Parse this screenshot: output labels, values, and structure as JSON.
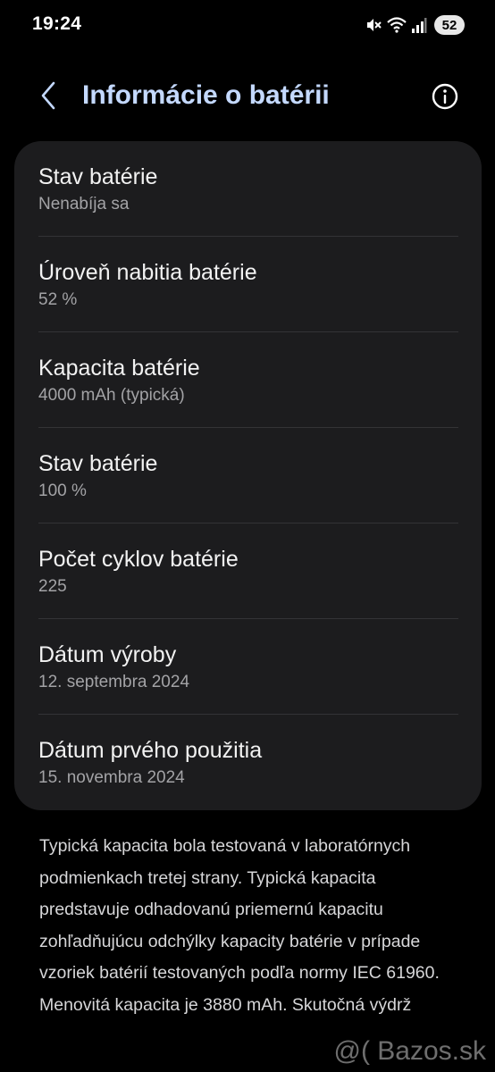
{
  "status_bar": {
    "time": "19:24",
    "battery_level": "52",
    "icons": [
      "mute-icon",
      "wifi-icon",
      "signal-icon",
      "battery-icon"
    ]
  },
  "header": {
    "title": "Informácie o batérii",
    "back_icon": "chevron-left-icon",
    "info_icon": "info-icon",
    "title_color": "#c4d9ff"
  },
  "items": [
    {
      "title": "Stav batérie",
      "value": "Nenabíja sa"
    },
    {
      "title": "Úroveň nabitia batérie",
      "value": "52 %"
    },
    {
      "title": "Kapacita batérie",
      "value": "4000 mAh (typická)"
    },
    {
      "title": "Stav batérie",
      "value": "100 %"
    },
    {
      "title": "Počet cyklov batérie",
      "value": "225"
    },
    {
      "title": "Dátum výroby",
      "value": "12. septembra 2024"
    },
    {
      "title": "Dátum prvého použitia",
      "value": "15. novembra 2024"
    }
  ],
  "footnote": "Typická kapacita bola testovaná v laboratórnych podmienkach tretej strany. Typická kapacita predstavuje odhadovanú priemernú kapacitu zohľadňujúcu odchýlky kapacity batérie v prípade vzoriek batérií testovaných podľa normy IEC 61960. Menovitá kapacita je 3880 mAh. Skutočná výdrž",
  "watermark": "Bazos.sk",
  "colors": {
    "background": "#000000",
    "card": "#1c1c1e",
    "divider": "#333336"
  }
}
